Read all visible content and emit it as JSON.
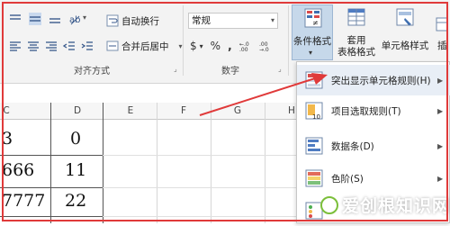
{
  "ribbon": {
    "alignment_group_label": "对齐方式",
    "number_group_label": "数字",
    "wrap_text_label": "自动换行",
    "merge_center_label": "合并后居中",
    "number_format_value": "常规",
    "currency_symbol": "$",
    "percent_symbol": "%",
    "comma_symbol": ",",
    "cond_format_label": "条件格式",
    "table_format_label_line1": "套用",
    "table_format_label_line2": "表格格式",
    "cell_styles_label": "单元格样式",
    "insert_partial_label": "插"
  },
  "columns": [
    "C",
    "D",
    "E",
    "F",
    "G",
    "H"
  ],
  "cells": {
    "c_row1": "3",
    "d_row1": "0",
    "c_row2": "666",
    "d_row2": "11",
    "c_row3": "7777",
    "d_row3": "22"
  },
  "menu": {
    "items": [
      {
        "label": "突出显示单元格规则(H)"
      },
      {
        "label": "项目选取规则(T)"
      },
      {
        "label": "数据条(D)"
      },
      {
        "label": "色阶(S)"
      }
    ]
  },
  "annotations": {
    "arrow_color": "#e03a3a",
    "frame_color": "#e03a3a"
  },
  "watermark": {
    "text": "爱创根知识网"
  }
}
